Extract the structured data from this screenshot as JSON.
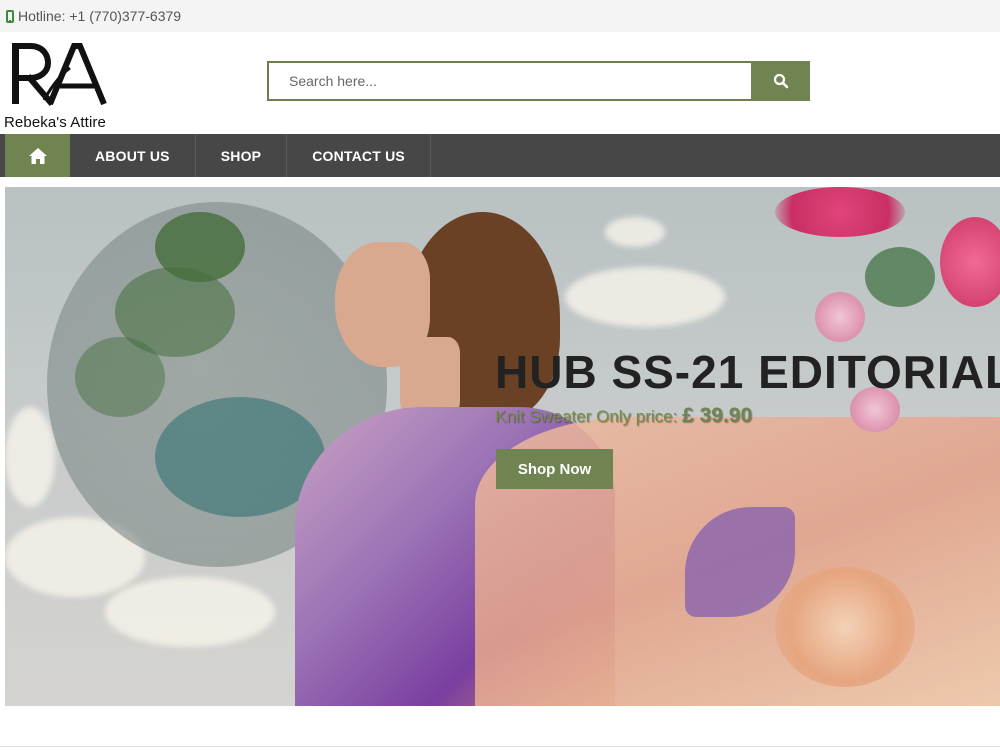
{
  "topbar": {
    "hotline": "Hotline: +1 (770)377-6379",
    "icon": "phone-icon"
  },
  "brand": {
    "name": "Rebeka's Attire",
    "monogram": "RA"
  },
  "search": {
    "placeholder": "Search here...",
    "icon": "search-icon"
  },
  "nav": {
    "home_icon": "home-icon",
    "items": [
      {
        "label": "ABOUT US"
      },
      {
        "label": "SHOP"
      },
      {
        "label": "CONTACT US"
      }
    ]
  },
  "hero": {
    "title": "HUB SS-21 EDITORIAL",
    "subtitle": "Knit Sweater Only price:",
    "price": "£ 39.90",
    "button": "Shop Now"
  },
  "colors": {
    "accent": "#6f8450",
    "nav_bg": "#474747",
    "topbar_bg": "#f4f4f4"
  }
}
